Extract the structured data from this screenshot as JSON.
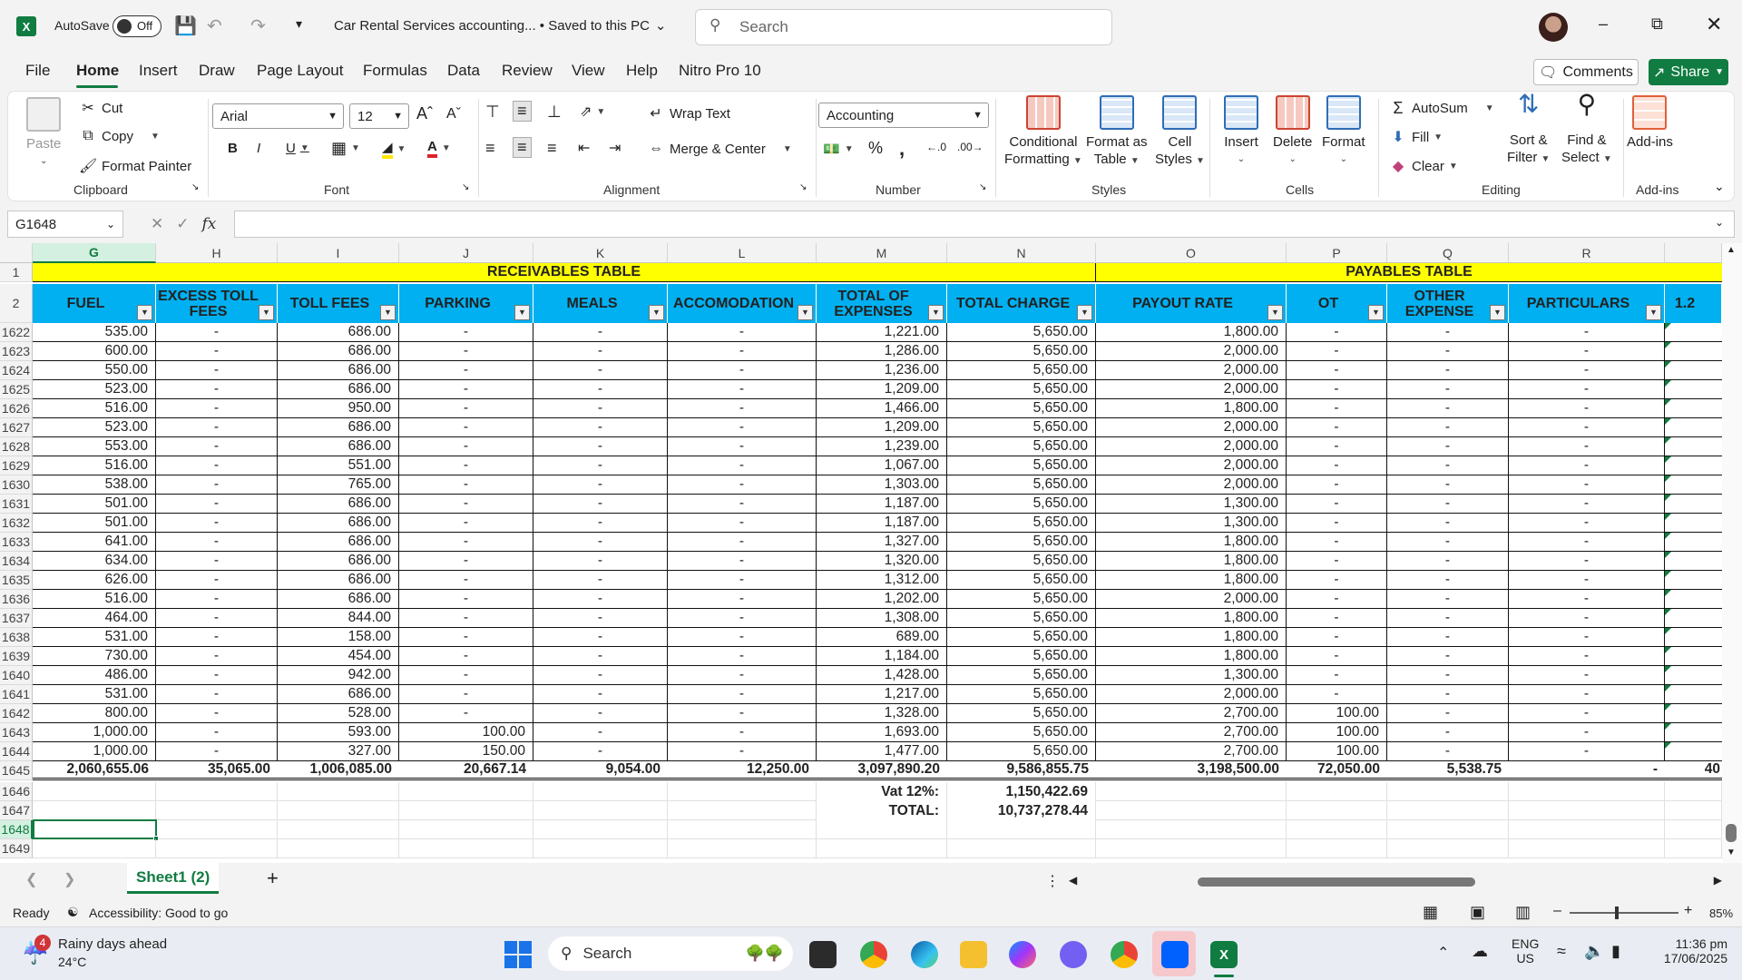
{
  "titlebar": {
    "autosave_label": "AutoSave",
    "autosave_state": "Off",
    "doc_title": "Car Rental Services accounting... • Saved to this PC",
    "search_placeholder": "Search"
  },
  "menu": {
    "items": [
      "File",
      "Home",
      "Insert",
      "Draw",
      "Page Layout",
      "Formulas",
      "Data",
      "Review",
      "View",
      "Help",
      "Nitro Pro 10"
    ],
    "comments_label": "Comments",
    "share_label": "Share"
  },
  "ribbon": {
    "clipboard": {
      "paste": "Paste",
      "cut": "Cut",
      "copy": "Copy",
      "format_painter": "Format Painter",
      "label": "Clipboard"
    },
    "font": {
      "name": "Arial",
      "size": "12",
      "label": "Font"
    },
    "alignment": {
      "wrap": "Wrap Text",
      "merge": "Merge & Center",
      "label": "Alignment"
    },
    "number": {
      "format": "Accounting",
      "label": "Number"
    },
    "styles": {
      "cond1": "Conditional",
      "cond2": "Formatting",
      "fmt1": "Format as",
      "fmt2": "Table",
      "cell1": "Cell",
      "cell2": "Styles",
      "label": "Styles"
    },
    "cells": {
      "insert": "Insert",
      "delete": "Delete",
      "format": "Format",
      "label": "Cells"
    },
    "editing": {
      "autosum": "AutoSum",
      "fill": "Fill",
      "clear": "Clear",
      "sort1": "Sort &",
      "sort2": "Filter",
      "find1": "Find &",
      "find2": "Select",
      "label": "Editing"
    },
    "addins": {
      "addins": "Add-ins",
      "label": "Add-ins"
    }
  },
  "formula_bar": {
    "name_box": "G1648",
    "fx": "fx",
    "formula": ""
  },
  "grid": {
    "columns": [
      "G",
      "H",
      "I",
      "J",
      "K",
      "L",
      "M",
      "N",
      "O",
      "P",
      "Q",
      "R"
    ],
    "band_receivables": "RECEIVABLES TABLE",
    "band_payables": "PAYABLES TABLE",
    "headers": [
      "FUEL",
      "EXCESS TOLL FEES",
      "TOLL FEES",
      "PARKING",
      "MEALS",
      "ACCOMODATION",
      "TOTAL OF EXPENSES",
      "TOTAL CHARGE",
      "PAYOUT RATE",
      "OT",
      "OTHER EXPENSE",
      "PARTICULARS",
      "1.2"
    ],
    "rows": [
      {
        "n": "1622",
        "v": [
          "535.00",
          "-",
          "686.00",
          "-",
          "-",
          "-",
          "1,221.00",
          "5,650.00",
          "1,800.00",
          "-",
          "-",
          "-"
        ]
      },
      {
        "n": "1623",
        "v": [
          "600.00",
          "-",
          "686.00",
          "-",
          "-",
          "-",
          "1,286.00",
          "5,650.00",
          "2,000.00",
          "-",
          "-",
          "-"
        ]
      },
      {
        "n": "1624",
        "v": [
          "550.00",
          "-",
          "686.00",
          "-",
          "-",
          "-",
          "1,236.00",
          "5,650.00",
          "2,000.00",
          "-",
          "-",
          "-"
        ]
      },
      {
        "n": "1625",
        "v": [
          "523.00",
          "-",
          "686.00",
          "-",
          "-",
          "-",
          "1,209.00",
          "5,650.00",
          "2,000.00",
          "-",
          "-",
          "-"
        ]
      },
      {
        "n": "1626",
        "v": [
          "516.00",
          "-",
          "950.00",
          "-",
          "-",
          "-",
          "1,466.00",
          "5,650.00",
          "1,800.00",
          "-",
          "-",
          "-"
        ]
      },
      {
        "n": "1627",
        "v": [
          "523.00",
          "-",
          "686.00",
          "-",
          "-",
          "-",
          "1,209.00",
          "5,650.00",
          "2,000.00",
          "-",
          "-",
          "-"
        ]
      },
      {
        "n": "1628",
        "v": [
          "553.00",
          "-",
          "686.00",
          "-",
          "-",
          "-",
          "1,239.00",
          "5,650.00",
          "2,000.00",
          "-",
          "-",
          "-"
        ]
      },
      {
        "n": "1629",
        "v": [
          "516.00",
          "-",
          "551.00",
          "-",
          "-",
          "-",
          "1,067.00",
          "5,650.00",
          "2,000.00",
          "-",
          "-",
          "-"
        ]
      },
      {
        "n": "1630",
        "v": [
          "538.00",
          "-",
          "765.00",
          "-",
          "-",
          "-",
          "1,303.00",
          "5,650.00",
          "2,000.00",
          "-",
          "-",
          "-"
        ]
      },
      {
        "n": "1631",
        "v": [
          "501.00",
          "-",
          "686.00",
          "-",
          "-",
          "-",
          "1,187.00",
          "5,650.00",
          "1,300.00",
          "-",
          "-",
          "-"
        ]
      },
      {
        "n": "1632",
        "v": [
          "501.00",
          "-",
          "686.00",
          "-",
          "-",
          "-",
          "1,187.00",
          "5,650.00",
          "1,300.00",
          "-",
          "-",
          "-"
        ]
      },
      {
        "n": "1633",
        "v": [
          "641.00",
          "-",
          "686.00",
          "-",
          "-",
          "-",
          "1,327.00",
          "5,650.00",
          "1,800.00",
          "-",
          "-",
          "-"
        ]
      },
      {
        "n": "1634",
        "v": [
          "634.00",
          "-",
          "686.00",
          "-",
          "-",
          "-",
          "1,320.00",
          "5,650.00",
          "1,800.00",
          "-",
          "-",
          "-"
        ]
      },
      {
        "n": "1635",
        "v": [
          "626.00",
          "-",
          "686.00",
          "-",
          "-",
          "-",
          "1,312.00",
          "5,650.00",
          "1,800.00",
          "-",
          "-",
          "-"
        ]
      },
      {
        "n": "1636",
        "v": [
          "516.00",
          "-",
          "686.00",
          "-",
          "-",
          "-",
          "1,202.00",
          "5,650.00",
          "2,000.00",
          "-",
          "-",
          "-"
        ]
      },
      {
        "n": "1637",
        "v": [
          "464.00",
          "-",
          "844.00",
          "-",
          "-",
          "-",
          "1,308.00",
          "5,650.00",
          "1,800.00",
          "-",
          "-",
          "-"
        ]
      },
      {
        "n": "1638",
        "v": [
          "531.00",
          "-",
          "158.00",
          "-",
          "-",
          "-",
          "689.00",
          "5,650.00",
          "1,800.00",
          "-",
          "-",
          "-"
        ]
      },
      {
        "n": "1639",
        "v": [
          "730.00",
          "-",
          "454.00",
          "-",
          "-",
          "-",
          "1,184.00",
          "5,650.00",
          "1,800.00",
          "-",
          "-",
          "-"
        ]
      },
      {
        "n": "1640",
        "v": [
          "486.00",
          "-",
          "942.00",
          "-",
          "-",
          "-",
          "1,428.00",
          "5,650.00",
          "1,300.00",
          "-",
          "-",
          "-"
        ]
      },
      {
        "n": "1641",
        "v": [
          "531.00",
          "-",
          "686.00",
          "-",
          "-",
          "-",
          "1,217.00",
          "5,650.00",
          "2,000.00",
          "-",
          "-",
          "-"
        ]
      },
      {
        "n": "1642",
        "v": [
          "800.00",
          "-",
          "528.00",
          "-",
          "-",
          "-",
          "1,328.00",
          "5,650.00",
          "2,700.00",
          "100.00",
          "-",
          "-"
        ]
      },
      {
        "n": "1643",
        "v": [
          "1,000.00",
          "-",
          "593.00",
          "100.00",
          "-",
          "-",
          "1,693.00",
          "5,650.00",
          "2,700.00",
          "100.00",
          "-",
          "-"
        ]
      },
      {
        "n": "1644",
        "v": [
          "1,000.00",
          "-",
          "327.00",
          "150.00",
          "-",
          "-",
          "1,477.00",
          "5,650.00",
          "2,700.00",
          "100.00",
          "-",
          "-"
        ]
      }
    ],
    "total_row": {
      "n": "1645",
      "v": [
        "2,060,655.06",
        "35,065.00",
        "1,006,085.00",
        "20,667.14",
        "9,054.00",
        "12,250.00",
        "3,097,890.20",
        "9,586,855.75",
        "3,198,500.00",
        "72,050.00",
        "5,538.75",
        "-"
      ],
      "extra": "40"
    },
    "vat_row": {
      "n": "1646",
      "label": "Vat 12%:",
      "value": "1,150,422.69"
    },
    "grand_row": {
      "n": "1647",
      "label": "TOTAL:",
      "value": "10,737,278.44"
    },
    "empty_rows": [
      "1648",
      "1649"
    ]
  },
  "sheets": {
    "active": "Sheet1 (2)",
    "add": "+"
  },
  "status": {
    "ready": "Ready",
    "accessibility": "Accessibility: Good to go",
    "zoom": "85%"
  },
  "taskbar": {
    "weather_badge": "4",
    "weather_title": "Rainy days ahead",
    "weather_temp": "24°C",
    "search": "Search",
    "lang1": "ENG",
    "lang2": "US",
    "time": "11:36 pm",
    "date": "17/06/2025"
  },
  "colors": {
    "accent": "#107c41",
    "header_blue": "#00b0f0",
    "band_yellow": "#ffff00"
  }
}
